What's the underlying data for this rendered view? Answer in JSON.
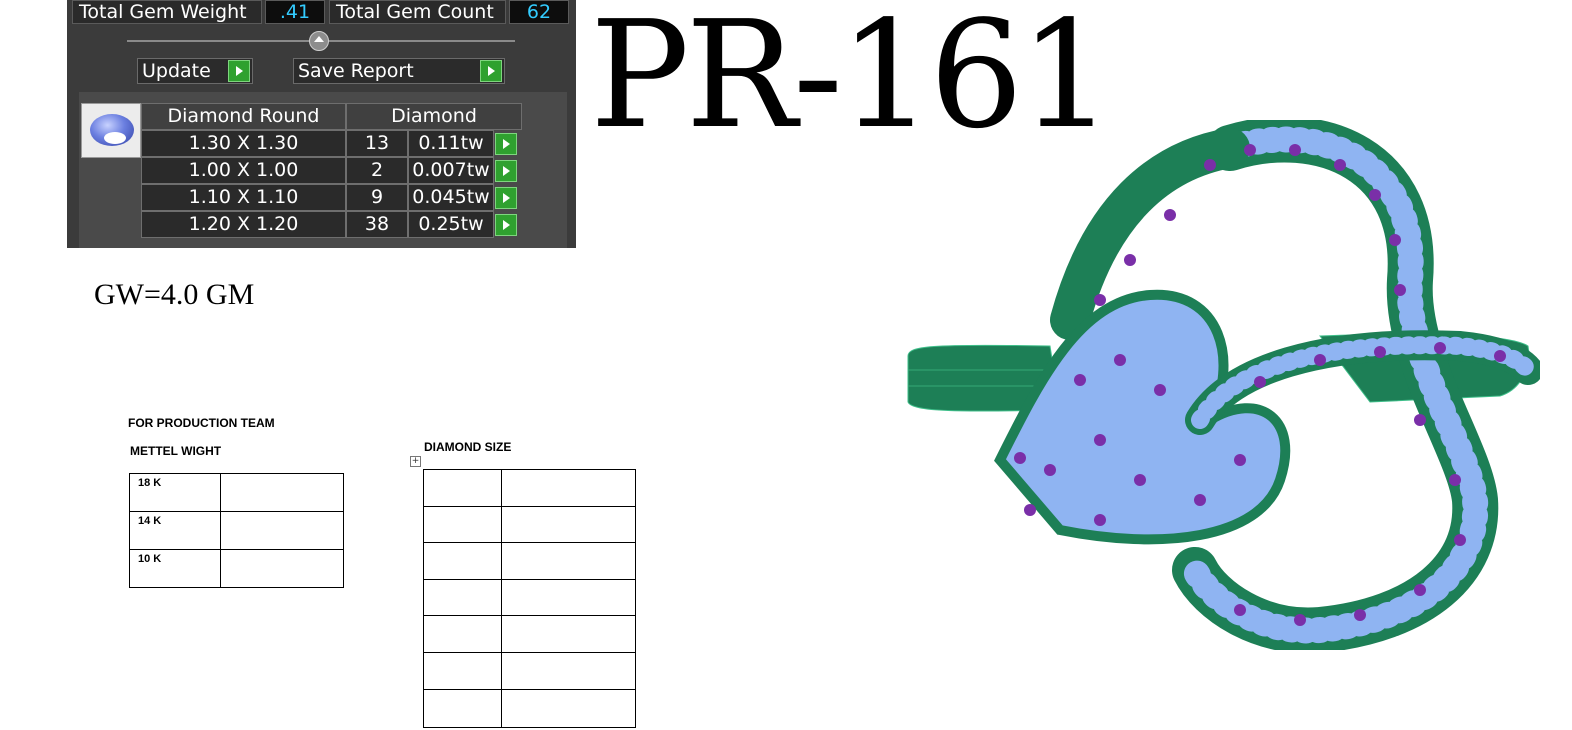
{
  "report": {
    "total_weight_label": "Total Gem Weight",
    "total_weight_value": ".41",
    "total_count_label": "Total Gem Count",
    "total_count_value": "62",
    "update_label": "Update",
    "save_report_label": "Save Report",
    "shape_header": "Diamond Round",
    "type_header": "Diamond",
    "rows": [
      {
        "size": "1.30 X 1.30",
        "count": "13",
        "weight": "0.11tw"
      },
      {
        "size": "1.00 X 1.00",
        "count": "2",
        "weight": "0.007tw"
      },
      {
        "size": "1.10 X 1.10",
        "count": "9",
        "weight": "0.045tw"
      },
      {
        "size": "1.20 X 1.20",
        "count": "38",
        "weight": "0.25tw"
      }
    ]
  },
  "design_code": "PR-161",
  "gross_weight": "GW=4.0 GM",
  "production": {
    "title": "FOR PRODUCTION TEAM",
    "metal_heading": "METTEL WIGHT",
    "metal_rows": [
      "18 K",
      "14 K",
      "10 K"
    ],
    "diamond_heading": "DIAMOND SIZE"
  },
  "colors": {
    "panel_bg": "#3b3b3b",
    "value_text": "#33ccff",
    "button_green": "#2fa12f",
    "ring_metal": "#1f8a5b",
    "stone_light": "#8fb4f2",
    "stone_dark": "#7a2fa8"
  },
  "icons": [
    "round-gem-icon",
    "play-arrow-icon",
    "table-move-handle-icon"
  ]
}
